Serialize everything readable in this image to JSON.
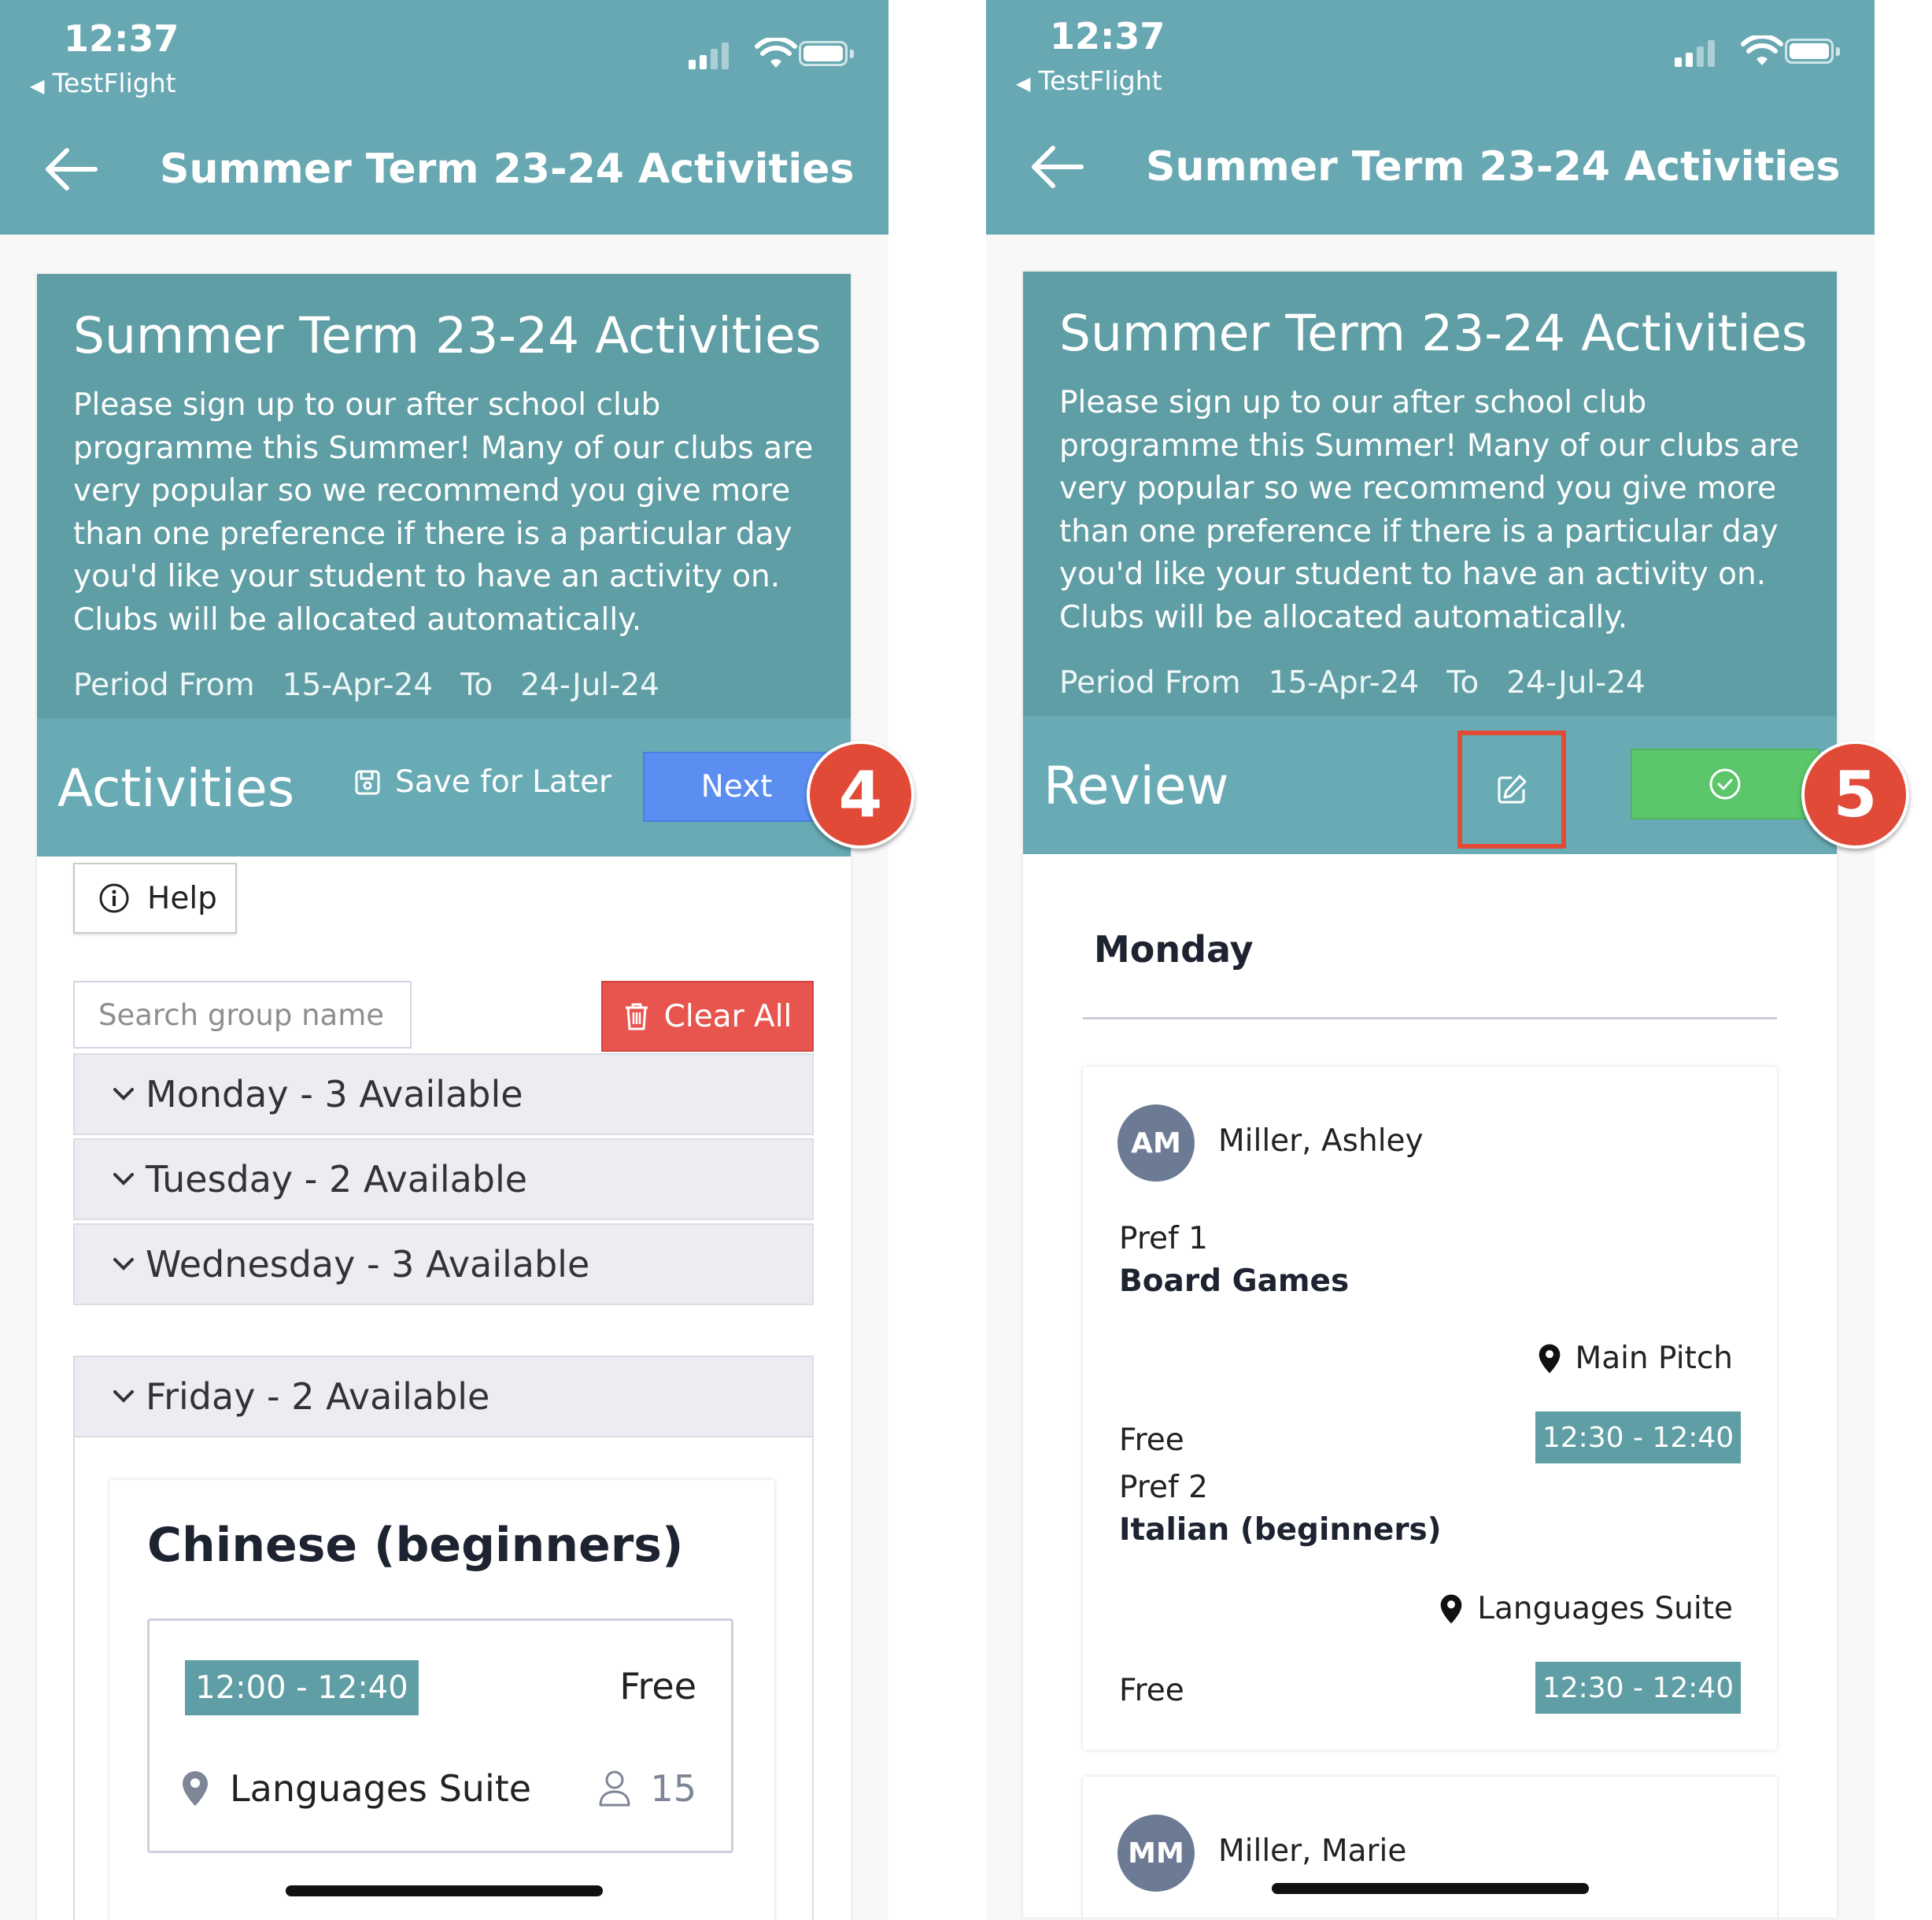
{
  "status_bar": {
    "time": "12:37",
    "back_app": "TestFlight",
    "icons": [
      "signal-icon",
      "wifi-icon",
      "battery-icon"
    ]
  },
  "nav": {
    "back_icon": "arrow-left-icon",
    "title": "Summer Term 23-24 Activities"
  },
  "event": {
    "title": "Summer Term 23-24 Activities",
    "description": "Please sign up to our after school club programme this Summer!  Many of our clubs are very popular so we recommend you give more than one preference if there is a particular day you'd like your student to have an activity on. Clubs will be allocated automatically.",
    "period_from_label": "Period From",
    "period_from": "15-Apr-24",
    "period_to_label": "To",
    "period_to": "24-Jul-24"
  },
  "left_screen": {
    "section_title": "Activities",
    "save_later_label": "Save for Later",
    "next_label": "Next",
    "step_badge": "4",
    "help_label": "Help",
    "search_placeholder": "Search group name",
    "clear_all_label": "Clear All",
    "days": [
      {
        "label": "Monday - 3 Available"
      },
      {
        "label": "Tuesday - 2 Available"
      },
      {
        "label": "Wednesday - 3 Available"
      },
      {
        "label": "Friday - 2 Available"
      }
    ],
    "club": {
      "title": "Chinese (beginners)",
      "time": "12:00 - 12:40",
      "price": "Free",
      "location": "Languages Suite",
      "capacity": "15"
    }
  },
  "right_screen": {
    "section_title": "Review",
    "edit_icon": "edit-icon",
    "confirm_icon": "check-circle-icon",
    "step_badge": "5",
    "day_heading": "Monday",
    "students": [
      {
        "initials": "AM",
        "name": "Miller, Ashley",
        "prefs": [
          {
            "label": "Pref 1",
            "club": "Board Games",
            "location": "Main Pitch",
            "price": "Free",
            "time": "12:30 - 12:40"
          },
          {
            "label": "Pref 2",
            "club": "Italian (beginners)",
            "location": "Languages Suite",
            "price": "Free",
            "time": "12:30 - 12:40"
          }
        ]
      },
      {
        "initials": "MM",
        "name": "Miller, Marie"
      }
    ]
  },
  "colors": {
    "header_teal": "#67a8b3",
    "card_header": "#5f9ea4",
    "next_blue": "#5b8ef0",
    "clear_red": "#e8554f",
    "confirm_green": "#5bc66a",
    "badge_red": "#e04a37"
  }
}
